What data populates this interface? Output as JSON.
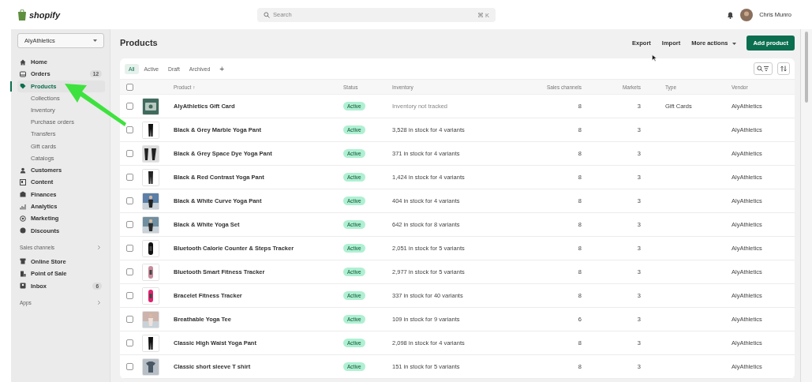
{
  "topbar": {
    "logo": "shopify",
    "search": {
      "placeholder": "Search",
      "shortcut": "⌘ K"
    },
    "user": "Chris Munro"
  },
  "sidebar": {
    "store": "AlyAthletics",
    "items": [
      {
        "label": "Home",
        "selected": false
      },
      {
        "label": "Orders",
        "badge": "12",
        "selected": false
      },
      {
        "label": "Products",
        "selected": true,
        "children": [
          {
            "label": "Collections"
          },
          {
            "label": "Inventory"
          },
          {
            "label": "Purchase orders"
          },
          {
            "label": "Transfers"
          },
          {
            "label": "Gift cards"
          },
          {
            "label": "Catalogs"
          }
        ]
      },
      {
        "label": "Customers",
        "selected": false
      },
      {
        "label": "Content",
        "selected": false
      },
      {
        "label": "Finances",
        "selected": false
      },
      {
        "label": "Analytics",
        "selected": false
      },
      {
        "label": "Marketing",
        "selected": false
      },
      {
        "label": "Discounts",
        "selected": false
      }
    ],
    "sales_channels": {
      "heading": "Sales channels",
      "items": [
        {
          "label": "Online Store"
        },
        {
          "label": "Point of Sale"
        },
        {
          "label": "Inbox",
          "badge": "6"
        }
      ]
    },
    "apps": {
      "heading": "Apps"
    }
  },
  "page": {
    "title": "Products",
    "actions": [
      "Export",
      "Import",
      "More actions"
    ],
    "primary": "Add product"
  },
  "tabs": [
    {
      "label": "All",
      "selected": true
    },
    {
      "label": "Active",
      "selected": false
    },
    {
      "label": "Draft",
      "selected": false
    },
    {
      "label": "Archived",
      "selected": false
    }
  ],
  "add_tab": "+",
  "table": {
    "select_all_checked": false,
    "columns": [
      "Product ↑",
      "Status",
      "Inventory",
      "Sales channels",
      "Markets",
      "Type",
      "Vendor"
    ],
    "rows": [
      {
        "product": "AlyAthletics Gift Card",
        "status": "Active",
        "inventory": "Inventory not tracked",
        "sales_channels": "8",
        "markets": "3",
        "type": "Gift Cards",
        "vendor": "AlyAthletics",
        "checked": false
      },
      {
        "product": "Black & Grey Marble Yoga Pant",
        "status": "Active",
        "inventory": "3,528 in stock for 4 variants",
        "sales_channels": "8",
        "markets": "3",
        "vendor": "AlyAthletics",
        "checked": false
      },
      {
        "product": "Black & Grey Space Dye Yoga Pant",
        "status": "Active",
        "inventory": "371 in stock for 4 variants",
        "sales_channels": "8",
        "markets": "3",
        "vendor": "AlyAthletics",
        "checked": false
      },
      {
        "product": "Black & Red Contrast Yoga Pant",
        "status": "Active",
        "inventory": "1,424 in stock for 4 variants",
        "sales_channels": "8",
        "markets": "3",
        "vendor": "AlyAthletics",
        "checked": false
      },
      {
        "product": "Black & White Curve Yoga Pant",
        "status": "Active",
        "inventory": "404 in stock for 4 variants",
        "sales_channels": "8",
        "markets": "3",
        "vendor": "AlyAthletics",
        "checked": false
      },
      {
        "product": "Black & White Yoga Set",
        "status": "Active",
        "inventory": "642 in stock for 8 variants",
        "sales_channels": "8",
        "markets": "3",
        "vendor": "AlyAthletics",
        "checked": false
      },
      {
        "product": "Bluetooth Calorie Counter & Steps Tracker",
        "status": "Active",
        "inventory": "2,051 in stock for 5 variants",
        "sales_channels": "8",
        "markets": "3",
        "vendor": "AlyAthletics",
        "checked": false
      },
      {
        "product": "Bluetooth Smart Fitness Tracker",
        "status": "Active",
        "inventory": "2,977 in stock for 5 variants",
        "sales_channels": "8",
        "markets": "3",
        "vendor": "AlyAthletics",
        "checked": false
      },
      {
        "product": "Bracelet Fitness Tracker",
        "status": "Active",
        "inventory": "337 in stock for 40 variants",
        "sales_channels": "8",
        "markets": "3",
        "vendor": "AlyAthletics",
        "checked": false
      },
      {
        "product": "Breathable Yoga Tee",
        "status": "Active",
        "inventory": "109 in stock for 9 variants",
        "sales_channels": "6",
        "markets": "3",
        "vendor": "AlyAthletics",
        "checked": false
      },
      {
        "product": "Classic High Waist Yoga Pant",
        "status": "Active",
        "inventory": "2,098 in stock for 4 variants",
        "sales_channels": "8",
        "markets": "3",
        "vendor": "AlyAthletics",
        "checked": false
      },
      {
        "product": "Classic short sleeve T shirt",
        "status": "Active",
        "inventory": "151 in stock for 5 variants",
        "sales_channels": "8",
        "markets": "3",
        "vendor": "AlyAthletics",
        "checked": false
      }
    ]
  }
}
